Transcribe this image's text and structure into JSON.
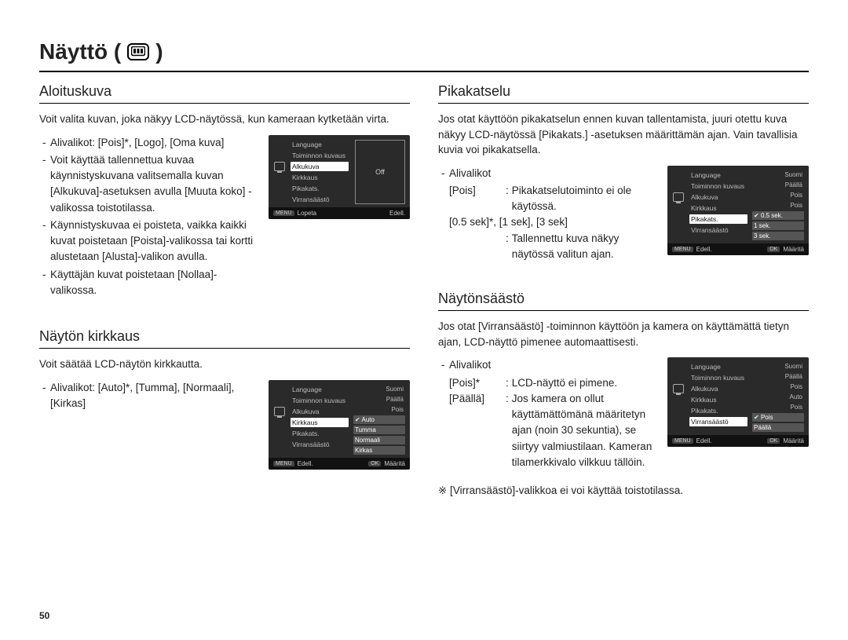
{
  "pageTitle": "Näyttö (",
  "pageTitleClose": ")",
  "pageNumber": "50",
  "left": {
    "aloituskuva": {
      "heading": "Aloituskuva",
      "intro": "Voit valita kuvan, joka näkyy LCD-näytössä, kun kameraan kytketään virta.",
      "b1": "Alivalikot: [Pois]*, [Logo], [Oma kuva]",
      "b2": "Voit käyttää tallennettua kuvaa käynnistyskuvana valitsemalla kuvan [Alkukuva]-asetuksen avulla [Muuta koko] -valikossa toistotilassa.",
      "b3": "Käynnistyskuvaa ei poisteta, vaikka kaikki kuvat poistetaan [Poista]-valikossa tai kortti alustetaan [Alusta]-valikon avulla.",
      "b4": "Käyttäjän kuvat poistetaan [Nollaa]-valikossa.",
      "lcd": {
        "menu": [
          "Language",
          "Toiminnon kuvaus",
          "Alkukuva",
          "Kirkkaus",
          "Pikakats.",
          "Virransäästö"
        ],
        "selectedIndex": 2,
        "panelText": "Off",
        "bottomLeft": "Lopeta",
        "bottomRight": "Edell."
      }
    },
    "kirkkaus": {
      "heading": "Näytön kirkkaus",
      "intro": "Voit säätää LCD-näytön kirkkautta.",
      "b1": "Alivalikot: [Auto]*, [Tumma], [Normaali], [Kirkas]",
      "lcd": {
        "menu": [
          "Language",
          "Toiminnon kuvaus",
          "Alkukuva",
          "Kirkkaus",
          "Pikakats.",
          "Virransäästö"
        ],
        "selectedIndex": 3,
        "rightTop": [
          "Suomi",
          "Päällä",
          "Pois"
        ],
        "options": [
          "Auto",
          "Tumma",
          "Normaali",
          "Kirkas"
        ],
        "checkedIndex": 0,
        "bottomLeft": "Edell.",
        "bottomRight": "Määritä"
      }
    }
  },
  "right": {
    "pikakatselu": {
      "heading": "Pikakatselu",
      "intro": "Jos otat käyttöön pikakatselun ennen kuvan tallentamista, juuri otettu kuva näkyy LCD-näytössä [Pikakats.] -asetuksen määrittämän ajan. Vain tavallisia kuvia voi pikakatsella.",
      "subHead": "Alivalikot",
      "def1k": "[Pois]",
      "def1v": "Pikakatselutoiminto ei ole käytössä.",
      "def2k": "[0.5 sek]*, [1 sek], [3 sek]",
      "def2v": "Tallennettu kuva näkyy näytössä valitun ajan.",
      "lcd": {
        "menu": [
          "Language",
          "Toiminnon kuvaus",
          "Alkukuva",
          "Kirkkaus",
          "Pikakats.",
          "Virransäästö"
        ],
        "selectedIndex": 4,
        "rightTop": [
          "Suomi",
          "Päällä",
          "Pois",
          "Pois"
        ],
        "options": [
          "0.5 sek.",
          "1 sek.",
          "3 sek."
        ],
        "checkedIndex": 0,
        "bottomLeft": "Edell.",
        "bottomRight": "Määritä"
      }
    },
    "saasto": {
      "heading": "Näytönsäästö",
      "intro": "Jos otat [Virransäästö] -toiminnon käyttöön ja kamera on käyttämättä tietyn ajan, LCD-näyttö pimenee automaattisesti.",
      "subHead": "Alivalikot",
      "def1k": "[Pois]*",
      "def1v": "LCD-näyttö ei pimene.",
      "def2k": "[Päällä]",
      "def2v": "Jos kamera on ollut käyttämättömänä määritetyn ajan (noin 30 sekuntia), se siirtyy valmiustilaan. Kameran tilamerkkivalo vilkkuu tällöin.",
      "footnote": "※ [Virransäästö]-valikkoa ei voi käyttää toistotilassa.",
      "lcd": {
        "menu": [
          "Language",
          "Toiminnon kuvaus",
          "Alkukuva",
          "Kirkkaus",
          "Pikakats.",
          "Virransäästö"
        ],
        "selectedIndex": 5,
        "rightTop": [
          "Suomi",
          "Päällä",
          "Pois",
          "Auto",
          "Pois"
        ],
        "options": [
          "Pois",
          "Päällä"
        ],
        "checkedIndex": 0,
        "bottomLeft": "Edell.",
        "bottomRight": "Määritä"
      }
    }
  }
}
